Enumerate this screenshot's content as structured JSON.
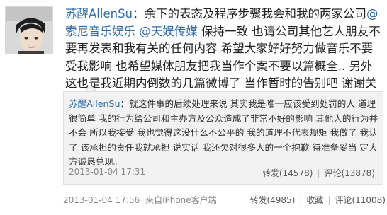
{
  "avatar": {
    "alt_icon": "user-avatar"
  },
  "post": {
    "author": "苏醒AllenSu",
    "colon": "：",
    "text_1": "余下的表态及程序步骤我会和我的两家公司",
    "mention_1": "@索尼音乐娱乐",
    "space": " ",
    "mention_2": "@天娱传媒",
    "text_2": " 保持一致  也请公司其他艺人朋友不要再发表和我有关的任何内容  希望大家好好努力做音乐不要受我影响  也希望媒体朋友把我当作个案不要以篇概全.. 另外这也是我近期内倒数的几篇微博了  当作暂时的告别吧  谢谢关注过我的朋友  祝一切顺利",
    "heart": "♥"
  },
  "quote": {
    "author": "苏醒AllenSu",
    "colon": "：",
    "text": "就这件事的后续处理来说  其实我是唯一应该受到处罚的人  道理很简单  我的行为给公司和主办方及公众造成了非常不好的影响  其他人的行为并不会  所以我接受  我也觉得这没什么不公平的  我的道理不代表规矩  我做了  我认了  该承担的责任我就承担  说实话  我还欠对很多人的一个抱歉  待准备妥当  定大方诚恳兑现。",
    "time": "2013-01-04 17:31",
    "repost": "转发(14578)",
    "comment": "评论(13878)",
    "separator": "|"
  },
  "meta": {
    "time": "2013-01-04 17:56",
    "source": "来自iPhone客户端",
    "repost": "转发(4985)",
    "favorite": "收藏",
    "comment": "评论(11008)",
    "separator": "|"
  },
  "colors": {
    "link": "#2d6aa8",
    "heart": "#e0242b",
    "quote_bg": "#f2f2f2"
  }
}
